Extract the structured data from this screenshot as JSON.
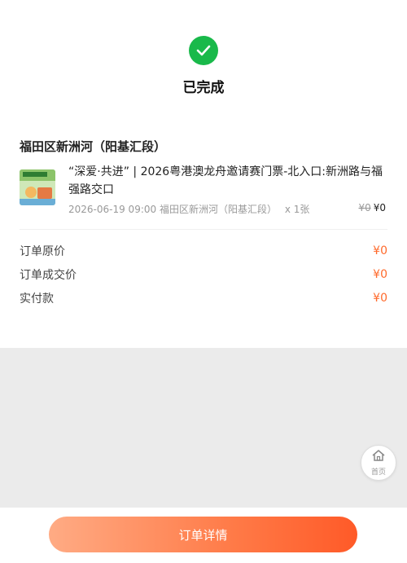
{
  "status": {
    "text": "已完成",
    "icon": "check-icon",
    "color": "#19b94a"
  },
  "order": {
    "venue": "福田区新洲河（阳基汇段）",
    "item": {
      "title": "“深爱·共进” | 2026粤港澳龙舟邀请赛门票-北入口:新洲路与福强路交口",
      "datetime": "2026-06-19 09:00",
      "location": "福田区新洲河（阳基汇段）",
      "quantity": "x 1张",
      "original_price": "¥0",
      "price": "¥0"
    },
    "summary": [
      {
        "label": "订单原价",
        "value": "¥0"
      },
      {
        "label": "订单成交价",
        "value": "¥0"
      },
      {
        "label": "实付款",
        "value": "¥0"
      }
    ]
  },
  "home_button": {
    "label": "首页",
    "icon": "home-icon"
  },
  "footer": {
    "detail_button": "订单详情"
  },
  "colors": {
    "accent": "#ff6a2c",
    "success": "#19b94a"
  }
}
